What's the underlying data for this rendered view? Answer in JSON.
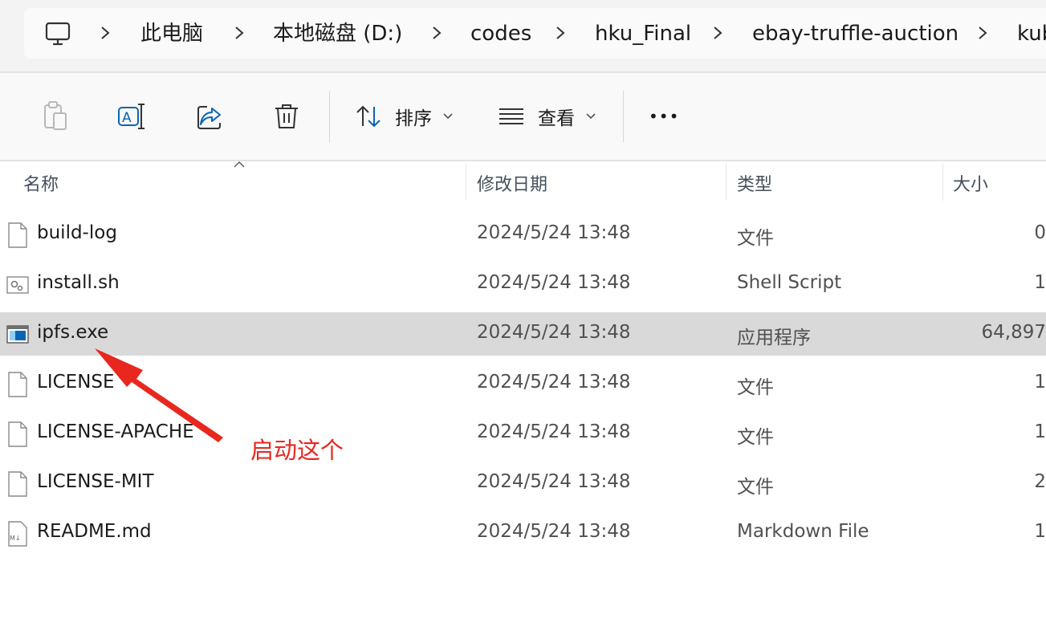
{
  "breadcrumb": {
    "root_icon": "computer-icon",
    "items": [
      "此电脑",
      "本地磁盘 (D:)",
      "codes",
      "hku_Final",
      "ebay-truffle-auction",
      "kub"
    ]
  },
  "toolbar": {
    "paste_icon": "clipboard-icon",
    "rename_icon": "rename-icon",
    "share_icon": "share-icon",
    "delete_icon": "trash-icon",
    "sort_label": "排序",
    "view_label": "查看",
    "more_label": "•••"
  },
  "columns": {
    "name": "名称",
    "date": "修改日期",
    "type": "类型",
    "size": "大小"
  },
  "files": [
    {
      "name": "build-log",
      "date": "2024/5/24 13:48",
      "type": "文件",
      "size": "0",
      "icon": "blank-file-icon",
      "selected": false
    },
    {
      "name": "install.sh",
      "date": "2024/5/24 13:48",
      "type": "Shell Script",
      "size": "1",
      "icon": "script-file-icon",
      "selected": false
    },
    {
      "name": "ipfs.exe",
      "date": "2024/5/24 13:48",
      "type": "应用程序",
      "size": "64,897",
      "icon": "exe-file-icon",
      "selected": true
    },
    {
      "name": "LICENSE",
      "date": "2024/5/24 13:48",
      "type": "文件",
      "size": "1",
      "icon": "blank-file-icon",
      "selected": false
    },
    {
      "name": "LICENSE-APACHE",
      "date": "2024/5/24 13:48",
      "type": "文件",
      "size": "1",
      "icon": "blank-file-icon",
      "selected": false
    },
    {
      "name": "LICENSE-MIT",
      "date": "2024/5/24 13:48",
      "type": "文件",
      "size": "2",
      "icon": "blank-file-icon",
      "selected": false
    },
    {
      "name": "README.md",
      "date": "2024/5/24 13:48",
      "type": "Markdown File",
      "size": "1",
      "icon": "markdown-file-icon",
      "selected": false
    }
  ],
  "annotation": {
    "text": "启动这个",
    "color": "#e8271f"
  },
  "colors": {
    "selection": "#d9d9d9",
    "accent_blue": "#0a64b4"
  }
}
